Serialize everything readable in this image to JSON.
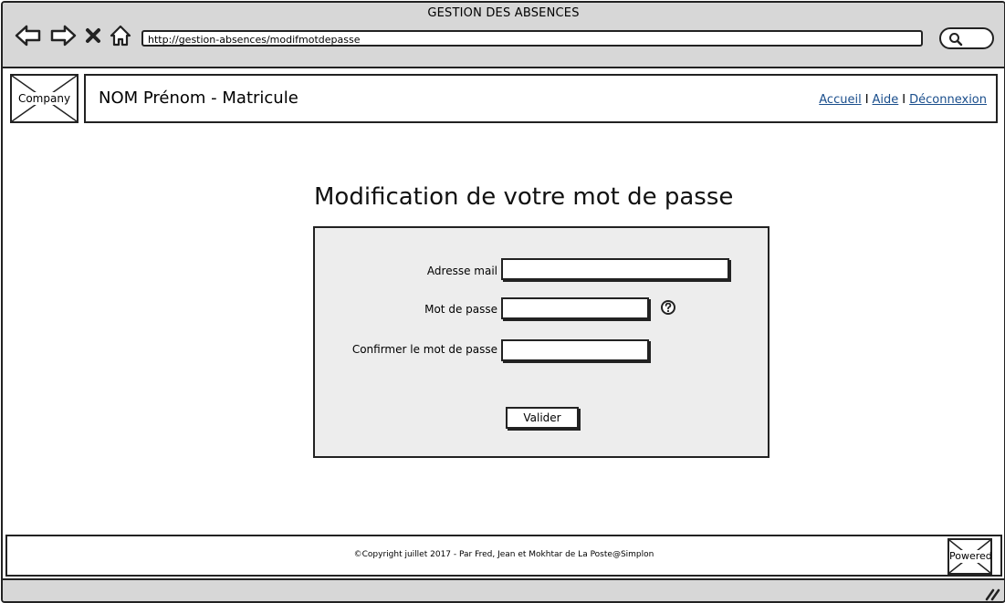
{
  "window": {
    "title": "GESTION DES ABSENCES",
    "url": "http://gestion-absences/modifmotdepasse"
  },
  "header": {
    "logo_label": "Company",
    "user_display": "NOM Prénom - Matricule",
    "nav_links": [
      "Accueil",
      "Aide",
      "Déconnexion"
    ],
    "separator": "I"
  },
  "main": {
    "title": "Modification de votre mot de passe",
    "form": {
      "email_label": "Adresse mail",
      "email_value": "",
      "password_label": "Mot de passe",
      "password_value": "",
      "confirm_label": "Confirmer le mot de passe",
      "confirm_value": "",
      "submit_label": "Valider"
    }
  },
  "footer": {
    "copyright": "©Copyright juillet 2017 - Par Fred, Jean et Mokhtar de La Poste@Simplon",
    "powered_label": "Powered"
  },
  "icons": {
    "back": "back-arrow-icon",
    "forward": "forward-arrow-icon",
    "stop": "close-icon",
    "home": "home-icon",
    "search": "search-icon",
    "help": "help-icon",
    "resize": "resize-grip-icon"
  },
  "colors": {
    "chrome": "#d7d7d7",
    "panel": "#ededed",
    "link": "#1a4e8c",
    "border": "#222222"
  }
}
